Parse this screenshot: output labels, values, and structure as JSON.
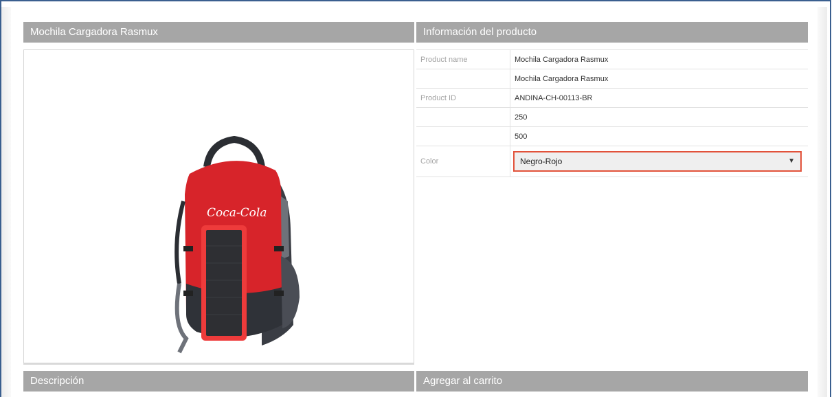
{
  "left_panel": {
    "title": "Mochila Cargadora Rasmux"
  },
  "image": {
    "brand_text": "Coca-Cola"
  },
  "info_panel": {
    "title": "Información del producto",
    "rows": [
      {
        "label": "Product name",
        "value": "Mochila Cargadora Rasmux"
      },
      {
        "label": "",
        "value": "Mochila Cargadora Rasmux"
      },
      {
        "label": "Product ID",
        "value": "ANDINA-CH-00113-BR"
      },
      {
        "label": "",
        "value": "250"
      },
      {
        "label": "",
        "value": "500"
      }
    ],
    "color": {
      "label": "Color",
      "selected": "Negro-Rojo"
    }
  },
  "description": {
    "title": "Descripción"
  },
  "cart": {
    "title": "Agregar al carrito"
  },
  "colors": {
    "header_bg": "#a6a6a6",
    "select_border": "#e2523a",
    "frame": "#3a5f8f"
  }
}
